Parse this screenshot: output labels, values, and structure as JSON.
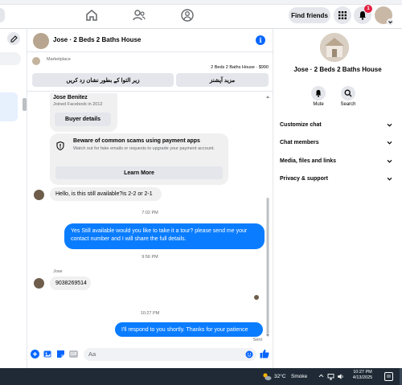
{
  "nav": {
    "find_friends": "Find friends",
    "notification_count": "1"
  },
  "chat": {
    "title": "Jose · 2 Beds 2 Baths House",
    "marketplace_label": "Marketplace",
    "listing_text": "2 Beds 2 Baths House · $990",
    "mark_sold_label": "زیر التوا کے بطور نشان زد کریں",
    "more_options_label": "مزید آپشنز",
    "seller_name": "Jose Benitez",
    "seller_joined": "Joined Facebook in 2012",
    "buyer_details_label": "Buyer details",
    "scam_title": "Beware of common scams using payment apps",
    "scam_body": "Watch out for fake emails or requests to upgrade your payment account.",
    "learn_more_label": "Learn More",
    "messages": [
      {
        "text": "Hello, is this still available?is 2-2 or 2-1"
      },
      {
        "time": "7:02 PM"
      },
      {
        "text": "Yes Still available would you like to take it a tour? please send me your contact number and I will share the full details."
      },
      {
        "time": "9:56 PM"
      },
      {
        "sender": "Jose",
        "text": "9038269514"
      },
      {
        "time": "10:27 PM"
      },
      {
        "text": "I'll respond to you shortly. Thanks for your patience"
      }
    ],
    "sent_status": "Sent",
    "composer_placeholder": "Aa"
  },
  "sidebar": {
    "name": "Jose · 2 Beds 2 Baths House",
    "mute_label": "Mute",
    "search_label": "Search",
    "menu": [
      "Customize chat",
      "Chat members",
      "Media, files and links",
      "Privacy & support"
    ]
  },
  "taskbar": {
    "temperature": "32°C",
    "weather": "Smoke",
    "time": "10:27 PM",
    "date": "4/13/2025"
  }
}
